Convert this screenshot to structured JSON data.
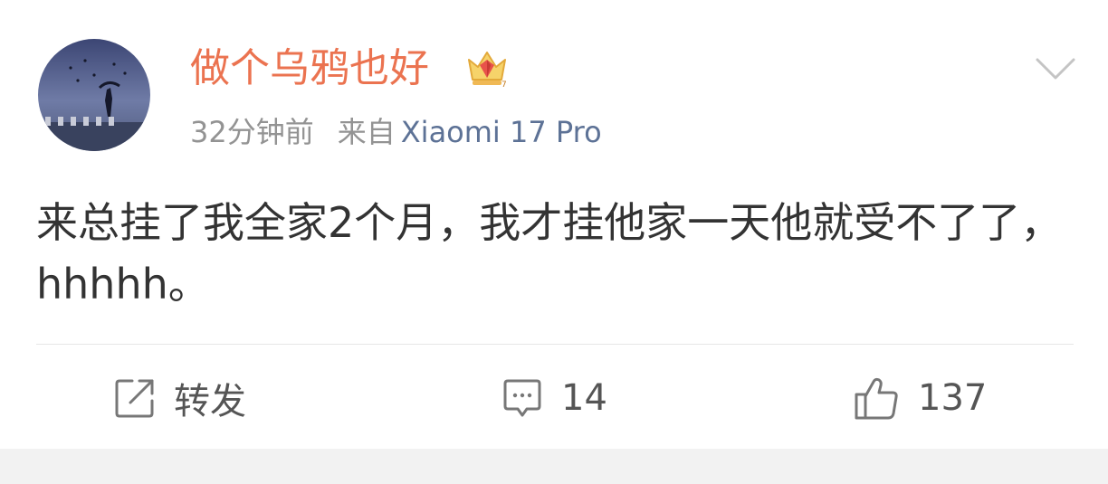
{
  "post": {
    "username": "做个乌鸦也好",
    "time": "32分钟前",
    "source_label": "来自",
    "device": "Xiaomi 17 Pro",
    "text": "来总挂了我全家2个月，我才挂他家一天他就受不了了，hhhhh。"
  },
  "actions": {
    "repost_label": "转发",
    "comment_count": "14",
    "like_count": "137"
  },
  "colors": {
    "username": "#eb7350",
    "device_link": "#5d7296",
    "meta_gray": "#939393",
    "text": "#333333",
    "page_background": "#f2f2f2"
  },
  "icons": {
    "badge": "crown-icon",
    "menu": "chevron-down-icon",
    "repost": "share-icon",
    "comment": "comment-icon",
    "like": "thumbs-up-icon"
  }
}
